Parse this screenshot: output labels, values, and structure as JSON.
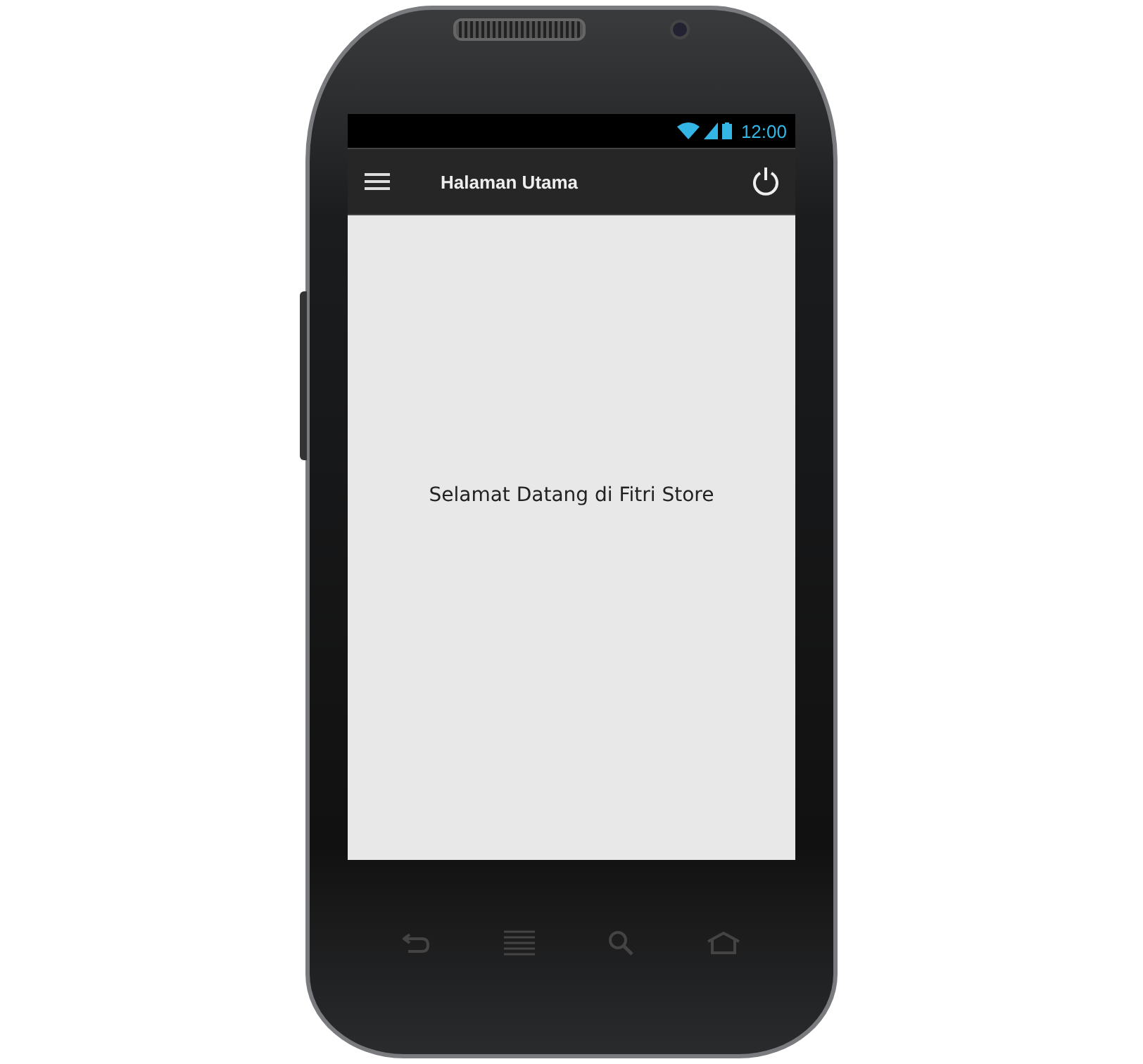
{
  "status_bar": {
    "time": "12:00"
  },
  "app_bar": {
    "title": "Halaman Utama"
  },
  "content": {
    "message": "Selamat Datang di Fitri Store"
  }
}
